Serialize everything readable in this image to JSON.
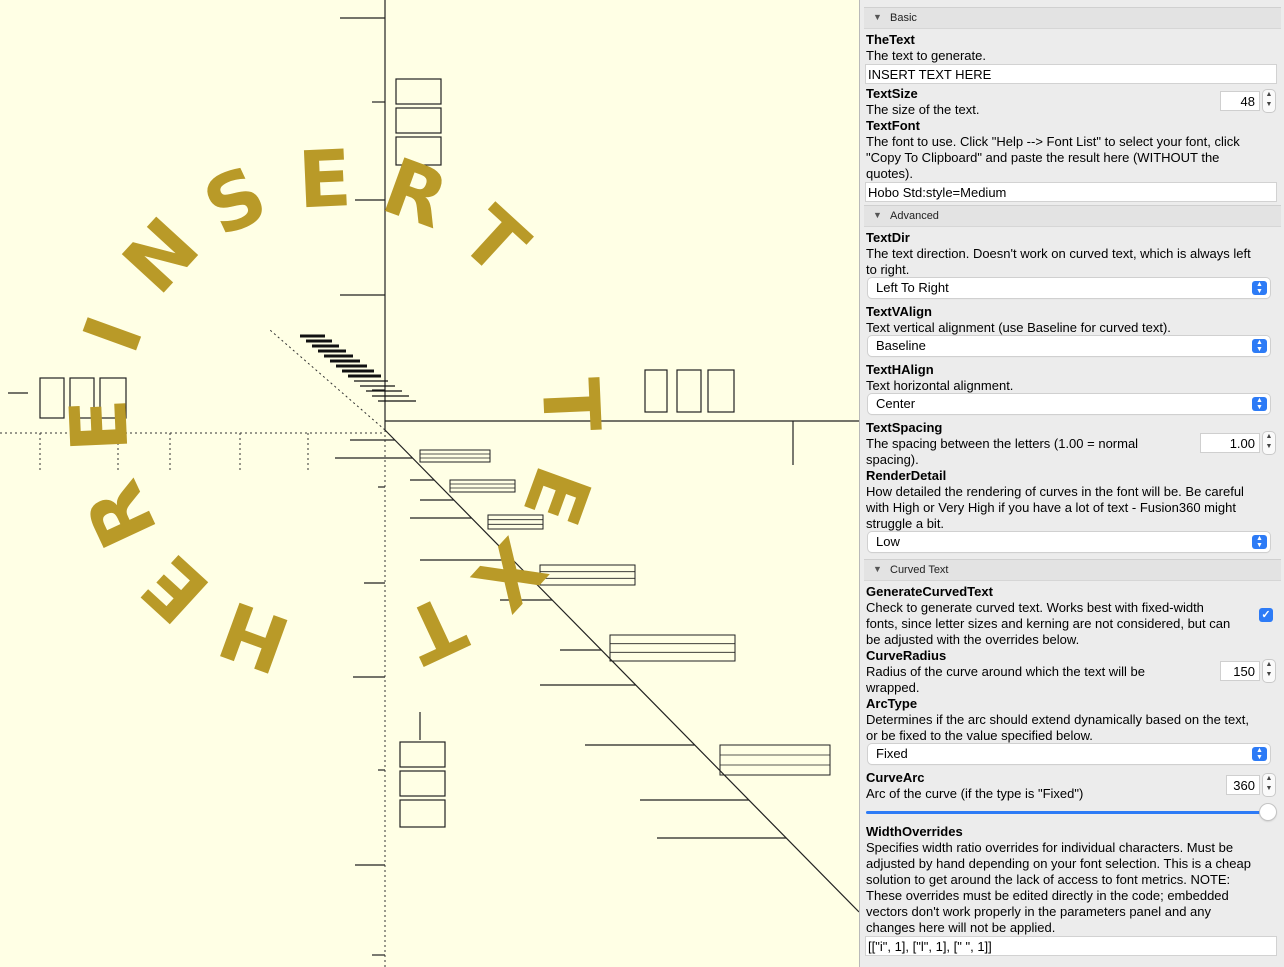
{
  "viewport": {
    "axis_labels": {
      "top": "200",
      "left": "-200",
      "right": "200",
      "bottom": "-200"
    },
    "model_text": [
      "I",
      "N",
      "S",
      "E",
      "R",
      "T",
      " ",
      "T",
      "E",
      "X",
      "T",
      " ",
      "H",
      "E",
      "R",
      "E"
    ],
    "model_color": "#b99a28"
  },
  "panel": {
    "basic": {
      "header": "Basic",
      "the_text": {
        "name": "TheText",
        "desc": "The text to generate.",
        "value": "INSERT TEXT HERE"
      },
      "text_size": {
        "name": "TextSize",
        "desc": "The size of the text.",
        "value": "48"
      },
      "text_font": {
        "name": "TextFont",
        "desc": [
          "The font to use. Click \"Help --> Font List\" to select your font, click",
          "\"Copy To Clipboard\" and paste the result here (WITHOUT the",
          "quotes)."
        ],
        "value": "Hobo Std:style=Medium"
      }
    },
    "advanced": {
      "header": "Advanced",
      "text_dir": {
        "name": "TextDir",
        "desc": [
          "The text direction. Doesn't work on curved text, which is always left",
          "to right."
        ],
        "value": "Left To Right"
      },
      "text_valign": {
        "name": "TextVAlign",
        "desc": "Text vertical alignment (use Baseline for curved text).",
        "value": "Baseline"
      },
      "text_halign": {
        "name": "TextHAlign",
        "desc": "Text horizontal alignment.",
        "value": "Center"
      },
      "text_spacing": {
        "name": "TextSpacing",
        "desc": [
          "The spacing between the letters (1.00 = normal",
          "spacing)."
        ],
        "value": "1.00"
      },
      "render_detail": {
        "name": "RenderDetail",
        "desc": [
          "How detailed the rendering of curves in the font will be. Be careful",
          "with High or Very High if you have a lot of text - Fusion360 might",
          "struggle a bit."
        ],
        "value": "Low"
      }
    },
    "curved": {
      "header": "Curved Text",
      "generate": {
        "name": "GenerateCurvedText",
        "desc": [
          "Check to generate curved text. Works best with fixed-width",
          "fonts, since letter sizes and kerning are not considered, but can",
          "be adjusted with the overrides below."
        ],
        "checked": true
      },
      "curve_radius": {
        "name": "CurveRadius",
        "desc": [
          "Radius of the curve around which the text will be",
          "wrapped."
        ],
        "value": "150"
      },
      "arc_type": {
        "name": "ArcType",
        "desc": [
          "Determines if the arc should extend dynamically based on the text,",
          "or be fixed to the value specified below."
        ],
        "value": "Fixed"
      },
      "curve_arc": {
        "name": "CurveArc",
        "desc": "Arc of the curve (if the type is \"Fixed\")",
        "value": "360",
        "slider_fraction": 1.0
      },
      "width_overrides": {
        "name": "WidthOverrides",
        "desc": [
          "Specifies width ratio overrides for individual characters. Must be",
          "adjusted by hand depending on your font selection. This is a cheap",
          "solution to get around the lack of access to font metrics. NOTE:",
          "These overrides must be edited directly in the code; embedded",
          "vectors don't work properly in the parameters panel and any",
          "changes here will not be applied."
        ],
        "value": "[[\"i\", 1], [\"l\", 1], [\" \", 1]]"
      }
    }
  }
}
